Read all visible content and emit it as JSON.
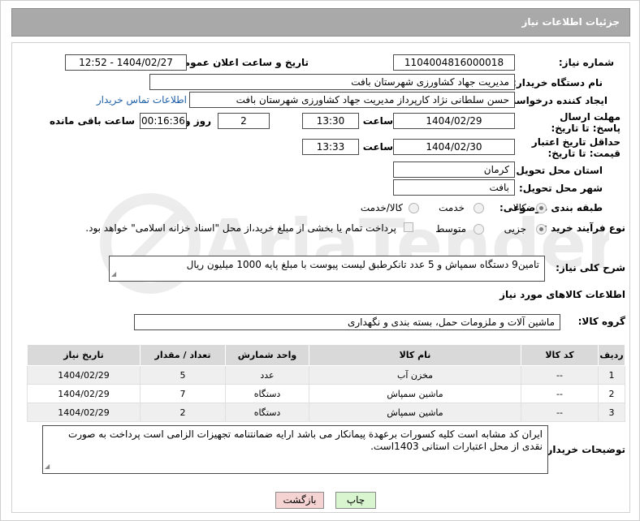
{
  "header": {
    "title": "جزئیات اطلاعات نیاز"
  },
  "fields": {
    "need_number_label": "شماره نیاز:",
    "need_number": "1104004816000018",
    "announce_label": "تاریخ و ساعت اعلان عمومی:",
    "announce_value": "1404/02/27 - 12:52",
    "buyer_org_label": "نام دستگاه خریدار:",
    "buyer_org": "مدیریت جهاد کشاورزی شهرستان بافت",
    "creator_label": "ایجاد کننده درخواست:",
    "creator": "حسن سلطانی نژاد کارپرداز مدیریت جهاد کشاورزی شهرستان بافت",
    "contact_link": "اطلاعات تماس خریدار",
    "deadline_label": "مهلت ارسال پاسخ: تا تاریخ:",
    "deadline_date": "1404/02/29",
    "time_label": "ساعت",
    "deadline_time": "13:30",
    "days_value": "2",
    "days_label": "روز و",
    "remaining_time": "00:16:36",
    "remaining_label": "ساعت باقی مانده",
    "validity_label": "حداقل تاریخ اعتبار قیمت: تا تاریخ:",
    "validity_date": "1404/02/30",
    "validity_time": "13:33",
    "province_label": "استان محل تحویل:",
    "province": "کرمان",
    "city_label": "شهر محل تحویل:",
    "city": "بافت",
    "category_label": "طبقه بندی موضوعی:",
    "category_options": [
      "کالا",
      "خدمت",
      "کالا/خدمت"
    ],
    "process_label": "نوع فرآیند خرید :",
    "process_options": [
      "جزیی",
      "متوسط"
    ],
    "payment_note": "پرداخت تمام یا بخشی از مبلغ خرید،از محل \"اسناد خزانه اسلامی\" خواهد بود."
  },
  "description": {
    "label": "شرح کلی نیاز:",
    "text": "تامین9 دستگاه سمپاش  و 5 عدد تانکرطبق لیست پیوست با مبلغ پایه 1000 میلیون ریال"
  },
  "goods": {
    "section_title": "اطلاعات کالاهای مورد نیاز",
    "group_label": "گروه کالا:",
    "group_value": "ماشین آلات و ملزومات حمل، بسته بندی و نگهداری",
    "columns": [
      "ردیف",
      "کد کالا",
      "نام کالا",
      "واحد شمارش",
      "تعداد / مقدار",
      "تاریخ نیاز"
    ],
    "rows": [
      [
        "1",
        "--",
        "مخزن آب",
        "عدد",
        "5",
        "1404/02/29"
      ],
      [
        "2",
        "--",
        "ماشین سمپاش",
        "دستگاه",
        "7",
        "1404/02/29"
      ],
      [
        "3",
        "--",
        "ماشین سمپاش",
        "دستگاه",
        "2",
        "1404/02/29"
      ]
    ]
  },
  "buyer_notes": {
    "label": "توضیحات خریدار:",
    "text": "ایران کد مشابه است کلیه کسورات برعهدة پیمانکار می باشد ارایه ضمانتنامه تجهیزات الزامی است  پرداخت  به صورت نقدی از محل اعتبارات استانی 1403است."
  },
  "buttons": {
    "print": "چاپ",
    "back": "بازگشت"
  },
  "watermark": {
    "text": "AriaTender.net"
  },
  "colors": {
    "title_bg": "#a9a9a9",
    "link": "#1f5fa8",
    "print_btn": "#d8f5d0",
    "back_btn": "#f6d3d3"
  }
}
